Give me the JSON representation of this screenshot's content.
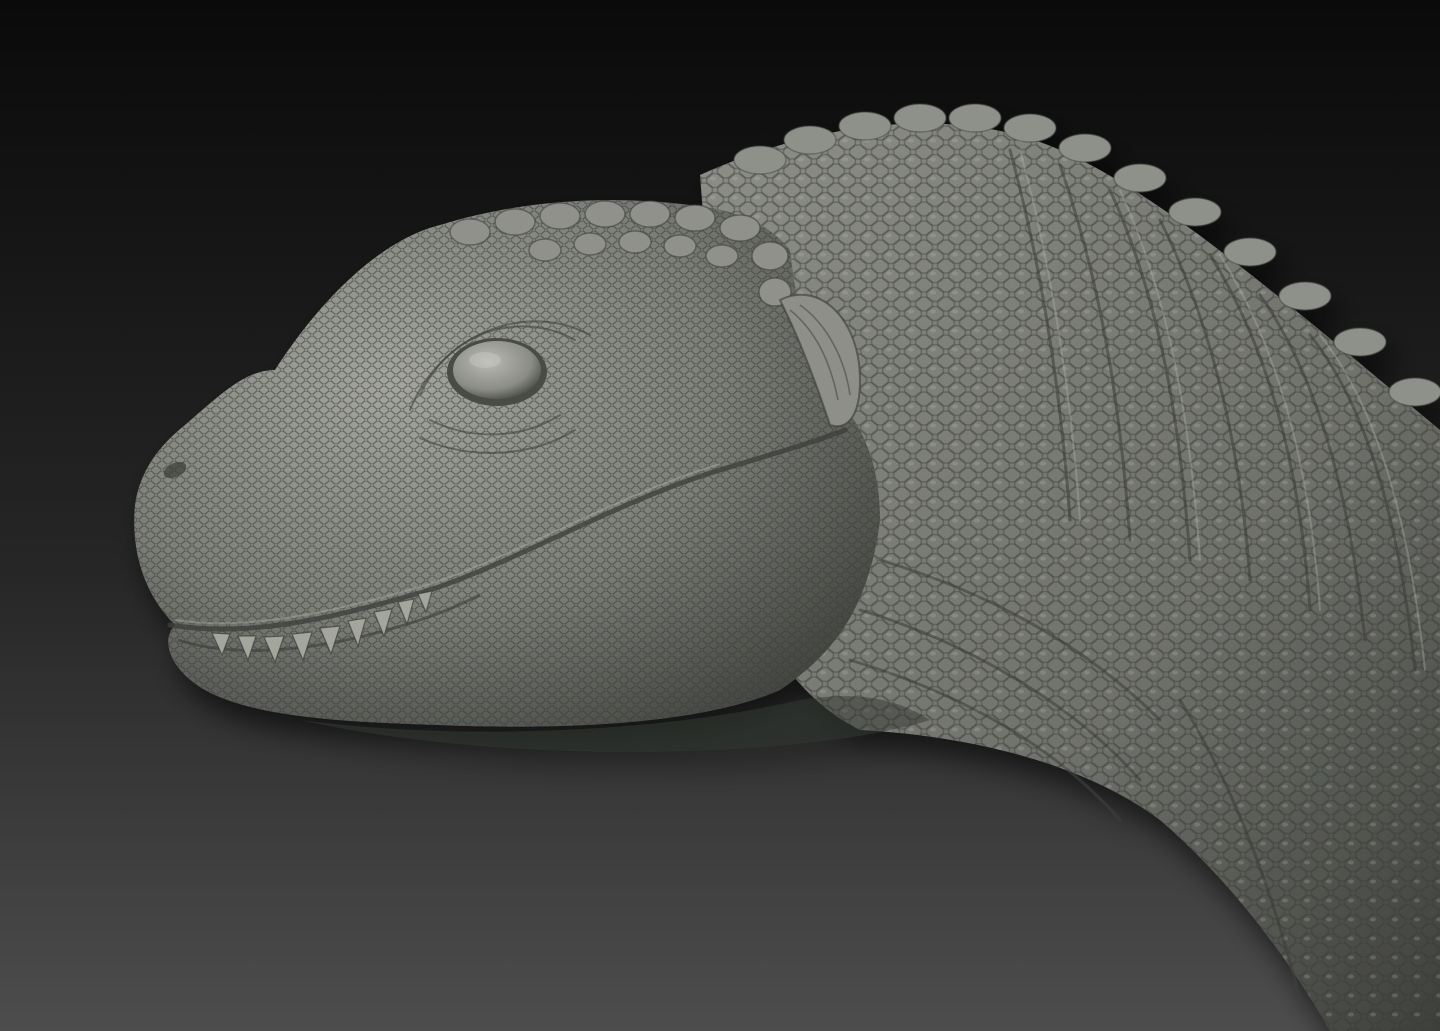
{
  "scene": {
    "background_top": "#0a0a0a",
    "background_bottom": "#4d4d4d",
    "sculpt_base": "#7c7e78",
    "sculpt_light": "#a3a59e",
    "sculpt_shadow": "#3f413d",
    "subject_icon": "dinosaur-head-sculpt"
  }
}
